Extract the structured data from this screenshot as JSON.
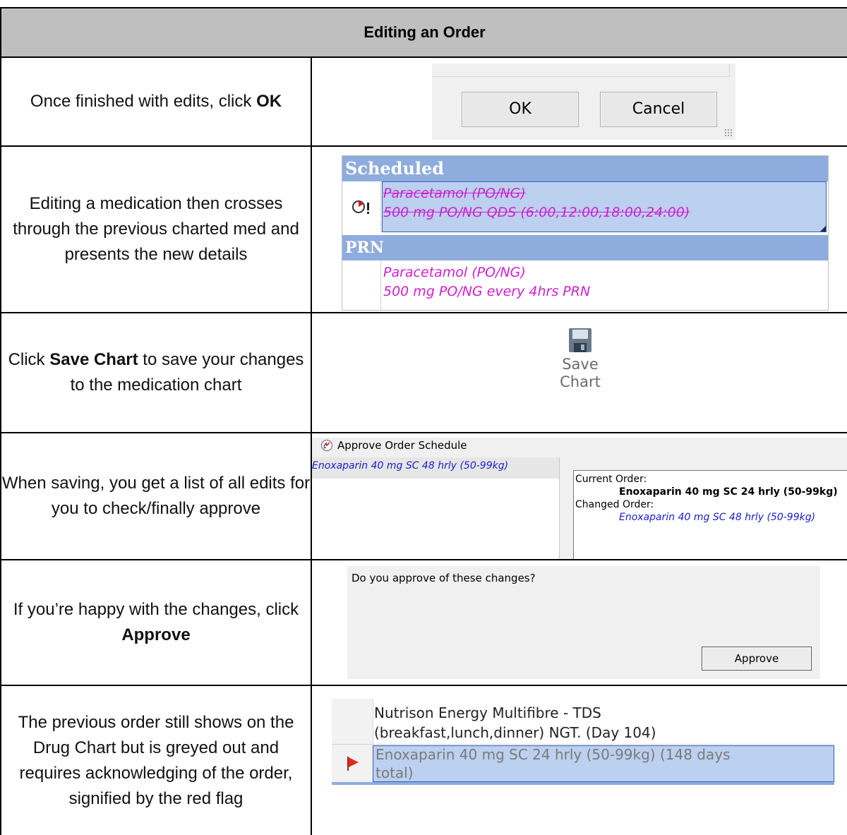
{
  "header": {
    "title": "Editing an Order"
  },
  "rows": [
    {
      "pre": "Once finished with edits, click ",
      "bold": "OK",
      "post": ""
    },
    {
      "pre": "Editing a medication then crosses through the previous charted med and presents the new details",
      "bold": "",
      "post": ""
    },
    {
      "pre": "Click ",
      "bold": "Save Chart",
      "post": " to save your changes to the medication chart"
    },
    {
      "pre": "When saving, you get a list of all edits for you to check/finally approve",
      "bold": "",
      "post": ""
    },
    {
      "pre": "If you’re happy with the changes, click ",
      "bold": "Approve",
      "post": ""
    },
    {
      "pre": "The previous order still shows on the Drug Chart but is greyed out and requires acknowledging of the order, signified by the red flag",
      "bold": "",
      "post": ""
    }
  ],
  "ok_dialog": {
    "ok_label": "OK",
    "cancel_label": "Cancel"
  },
  "med_list": {
    "scheduled_header": "Scheduled",
    "scheduled_line1": "Paracetamol (PO/NG)",
    "scheduled_line2": "500 mg PO/NG QDS (6:00,12:00,18:00,24:00)",
    "prn_header": "PRN",
    "prn_line1": "Paracetamol (PO/NG)",
    "prn_line2": "500 mg PO/NG every 4hrs PRN",
    "strike_color": "#d01fd0",
    "header_color": "#8eacde"
  },
  "save_chart": {
    "line1": "Save",
    "line2": "Chart",
    "icon": "floppy-disk-icon"
  },
  "approve_schedule": {
    "title": "Approve Order Schedule",
    "list_item": "Enoxaparin 40 mg SC 48 hrly (50-99kg)",
    "current_label": "Current Order:",
    "current_value": "Enoxaparin 40 mg SC 24 hrly (50-99kg)",
    "changed_label": "Changed Order:",
    "changed_value": "Enoxaparin 40 mg SC 48 hrly (50-99kg)"
  },
  "approve_dialog": {
    "question": "Do you approve of these changes?",
    "approve_label": "Approve"
  },
  "drug_chart": {
    "row1_line1": "Nutrison Energy Multifibre - TDS",
    "row1_line2": "(breakfast,lunch,dinner) NGT. (Day 104)",
    "row2_line1": "Enoxaparin 40 mg SC 24 hrly (50-99kg) (148 days",
    "row2_line2": "total)",
    "flag_color": "#e02a1c"
  }
}
